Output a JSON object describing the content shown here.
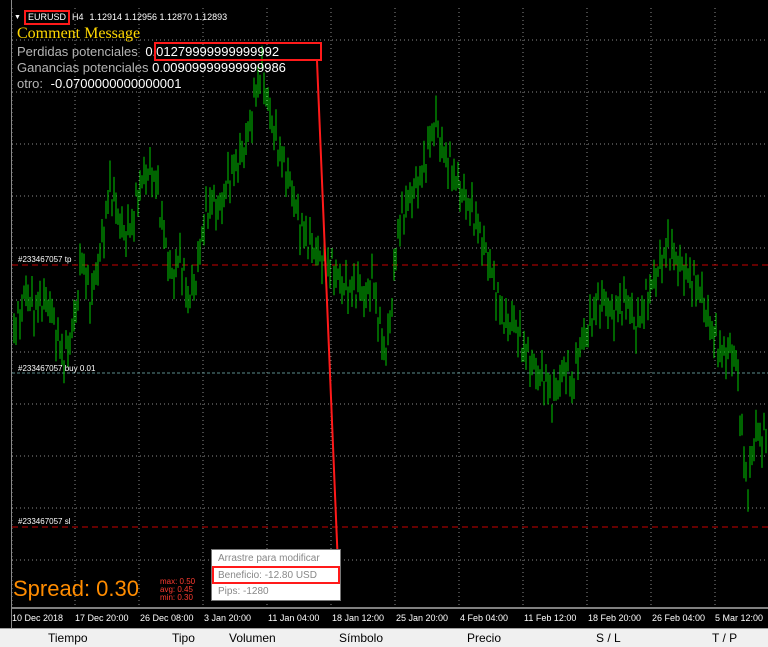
{
  "header": {
    "symbol": "EURUSD",
    "timeframe": "H4",
    "ohlc": "1.12914 1.12956 1.12870 1.12893"
  },
  "comment": {
    "title": "Comment Message",
    "perdidas_label": "Perdidas potenciales",
    "perdidas_value": "0.01279999999999992",
    "ganancias_label": "Ganancias potenciales",
    "ganancias_value": "0.00909999999999986",
    "otro_label": "otro:",
    "otro_value": "-0.0700000000000001"
  },
  "levels": {
    "tp": "#233467057 tp",
    "buy": "#233467057 buy 0.01",
    "sl": "#233467057 sl"
  },
  "spread": {
    "label": "Spread: 0.30",
    "max": "max: 0.50",
    "avg": "avg: 0.45",
    "min": "min: 0.30"
  },
  "tooltip": {
    "line1": "Arrastre para modificar",
    "line2": "Beneficio: -12.80 USD",
    "line3": "Pips: -1280"
  },
  "time_axis": [
    "10 Dec 2018",
    "17 Dec 20:00",
    "26 Dec 08:00",
    "3 Jan 20:00",
    "11 Jan 04:00",
    "18 Jan 12:00",
    "25 Jan 20:00",
    "4 Feb 04:00",
    "11 Feb 12:00",
    "18 Feb 20:00",
    "26 Feb 04:00",
    "5 Mar 12:00"
  ],
  "terminal_columns": [
    "Tiempo",
    "Tipo",
    "Volumen",
    "Símbolo",
    "Precio",
    "S / L",
    "T / P"
  ],
  "colors": {
    "candles": "#00c800",
    "tp_line": "#c80000",
    "sl_line": "#c80000",
    "buy_line": "#5a8c8c",
    "grid": "#8a8a8a",
    "highlight": "#ff1a1a",
    "spread": "#ff8c00"
  }
}
